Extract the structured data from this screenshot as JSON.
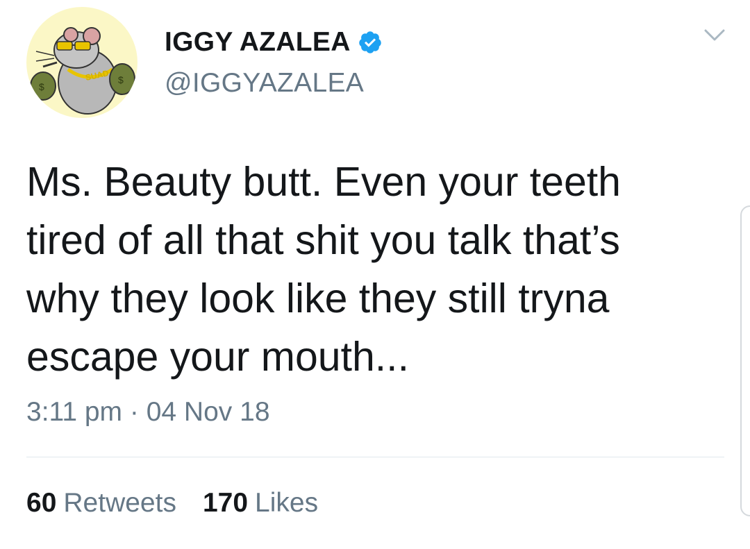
{
  "tweet": {
    "display_name": "IGGY AZALEA",
    "handle": "@IGGYAZALEA",
    "text": "Ms. Beauty butt. Even your teeth\ntired of all that shit you talk that’s\nwhy they look like they still tryna\nescape your mouth...",
    "time": "3:11 pm",
    "separator": "·",
    "date": "04 Nov 18",
    "retweets_count": "60",
    "retweets_label": "Retweets",
    "likes_count": "170",
    "likes_label": "Likes",
    "avatar_text": "SUAD"
  },
  "colors": {
    "text_primary": "#14171a",
    "text_secondary": "#657786",
    "verified_blue": "#1da1f2",
    "avatar_bg": "#fbf7c6",
    "divider": "#e1e8ed"
  },
  "icons": {
    "verified": "verified-badge-icon",
    "menu": "chevron-down-icon"
  }
}
